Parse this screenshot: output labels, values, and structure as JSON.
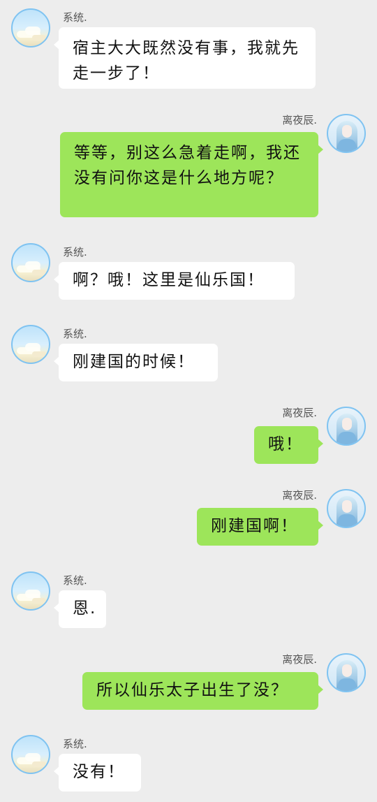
{
  "contacts": {
    "system": {
      "name": "系统.",
      "avatar_icon": "sky-clouds-avatar"
    },
    "user": {
      "name": "离夜辰.",
      "avatar_icon": "anime-character-avatar"
    }
  },
  "colors": {
    "background": "#ededed",
    "incoming_bubble": "#ffffff",
    "outgoing_bubble": "#9de55a",
    "avatar_ring": "#7fc3f1"
  },
  "messages": [
    {
      "side": "left",
      "sender": "系统.",
      "text": "宿主大大既然没有事，我就先走一步了！"
    },
    {
      "side": "right",
      "sender": "离夜辰.",
      "text": "等等，别这么急着走啊，我还没有问你这是什么地方呢？"
    },
    {
      "side": "left",
      "sender": "系统.",
      "text": "啊？哦！这里是仙乐国！"
    },
    {
      "side": "left",
      "sender": "系统.",
      "text": "刚建国的时候！"
    },
    {
      "side": "right",
      "sender": "离夜辰.",
      "text": "哦！"
    },
    {
      "side": "right",
      "sender": "离夜辰.",
      "text": "刚建国啊！"
    },
    {
      "side": "left",
      "sender": "系统.",
      "text": "恩."
    },
    {
      "side": "right",
      "sender": "离夜辰.",
      "text": "所以仙乐太子出生了没？"
    },
    {
      "side": "left",
      "sender": "系统.",
      "text": "没有！"
    }
  ]
}
